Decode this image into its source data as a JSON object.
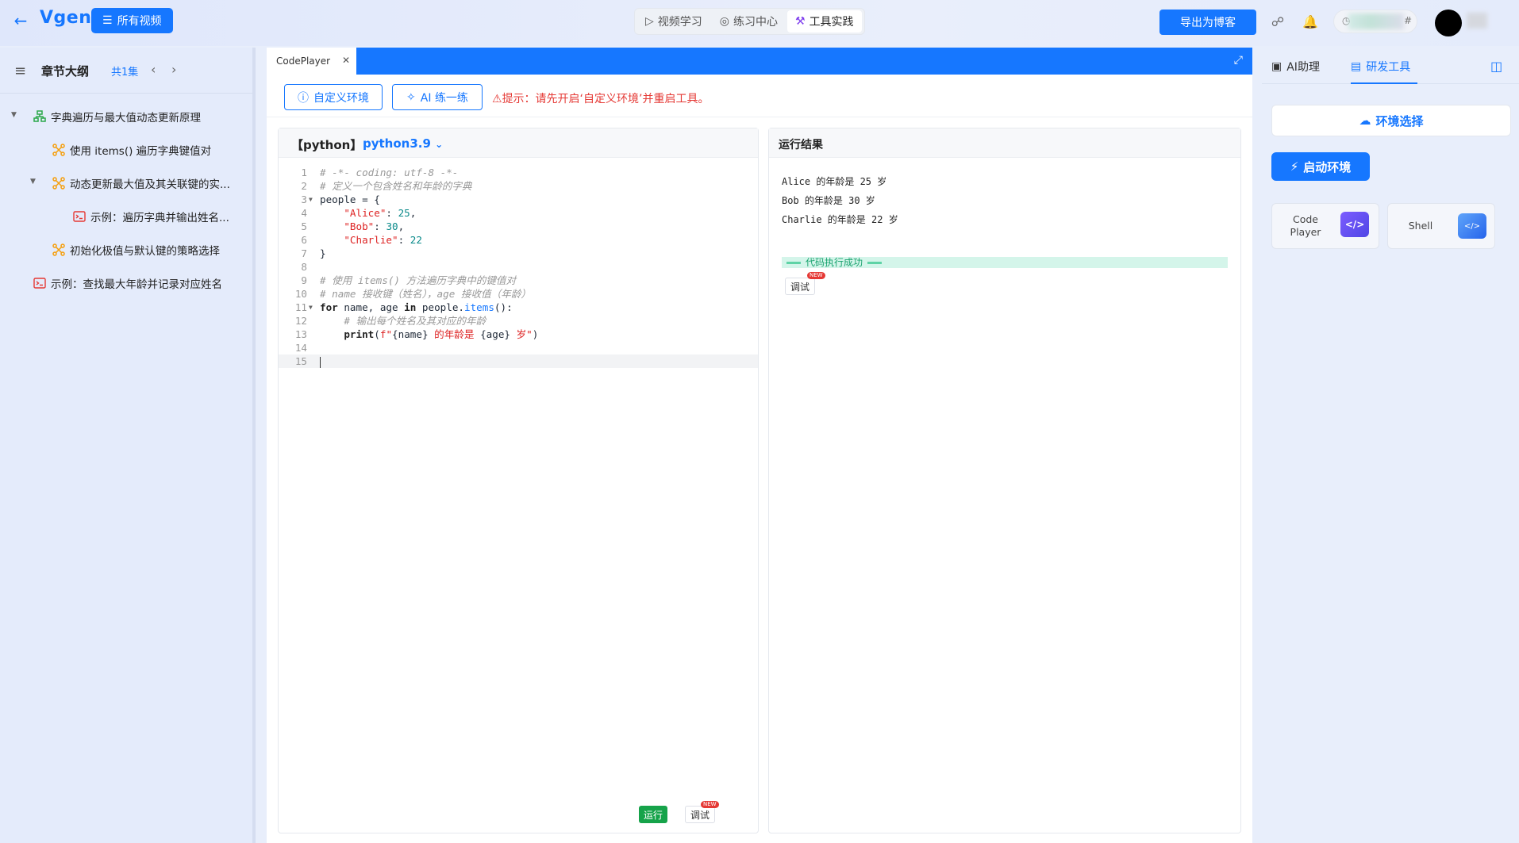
{
  "topbar": {
    "logo": "Vgen",
    "all_videos": "所有视频",
    "tabs": [
      {
        "label": "视频学习",
        "icon": "play-icon"
      },
      {
        "label": "练习中心",
        "icon": "target-icon"
      },
      {
        "label": "工具实践",
        "icon": "wrench-icon"
      }
    ],
    "export_label": "导出为博客"
  },
  "sidebar": {
    "title": "章节大纲",
    "count": "共1集",
    "tree": [
      {
        "label": "字典遍历与最大值动态更新原理",
        "icon": "tree-icon",
        "level": 0
      },
      {
        "label": "使用 items() 遍历字典键值对",
        "icon": "node-icon",
        "level": 1
      },
      {
        "label": "动态更新最大值及其关联键的实...",
        "icon": "node-icon",
        "level": 1
      },
      {
        "label": "示例：遍历字典并输出姓名...",
        "icon": "terminal-icon",
        "level": 2
      },
      {
        "label": "初始化极值与默认键的策略选择",
        "icon": "node-icon",
        "level": 1
      },
      {
        "label": "示例：查找最大年龄并记录对应姓名",
        "icon": "terminal-icon",
        "level": 0
      }
    ]
  },
  "center": {
    "tab_label": "CodePlayer",
    "custom_env": "自定义环境",
    "ai_practice": "AI 练一练",
    "warning": "提示：请先开启‘自定义环境’并重启工具。",
    "editor": {
      "lang": "【python】",
      "version": "python3.9",
      "debug": "调试",
      "new": "NEW",
      "run": "运行"
    },
    "result": {
      "title": "运行结果",
      "lines": [
        "Alice 的年龄是 25 岁",
        "Bob 的年龄是 30 岁",
        "Charlie 的年龄是 22 岁"
      ],
      "success": "代码执行成功",
      "debug": "调试",
      "new": "NEW"
    }
  },
  "code": [
    "# -*- coding: utf-8 -*-",
    "# 定义一个包含姓名和年龄的字典",
    "people = {",
    "    \"Alice\": 25,",
    "    \"Bob\": 30,",
    "    \"Charlie\": 22",
    "}",
    "",
    "# 使用 items() 方法遍历字典中的键值对",
    "# name 接收键（姓名），age 接收值（年龄）",
    "for name, age in people.items():",
    "    # 输出每个姓名及其对应的年龄",
    "    print(f\"{name} 的年龄是 {age} 岁\")",
    "",
    ""
  ],
  "rightpanel": {
    "tab_ai": "AI助理",
    "tab_dev": "研发工具",
    "env_select": "环境选择",
    "start_env": "启动环境",
    "cards": [
      {
        "label": "Code Player"
      },
      {
        "label": "Shell"
      }
    ]
  },
  "colors": {
    "accent": "#1677ff",
    "warning": "#e53935",
    "success": "#1aa36f"
  }
}
